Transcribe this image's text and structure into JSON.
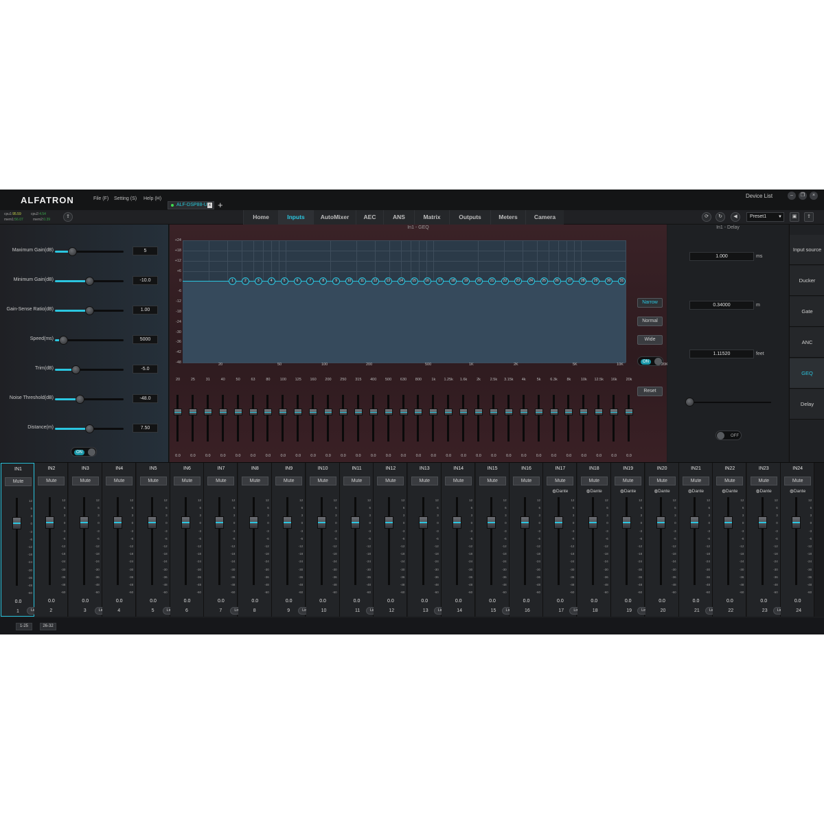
{
  "app": {
    "logo": "ALFATRON",
    "menu": [
      "File (F)",
      "Setting (S)",
      "Help (H)"
    ],
    "device_tab": "ALF-DSP88-U",
    "device_tab_close": "x",
    "add_tab": "+",
    "device_list": "Device List",
    "window_buttons": [
      "–",
      "❐",
      "×"
    ]
  },
  "status": {
    "cpu1_label": "cpu1:",
    "cpu1_value": "95.59",
    "cpu2_label": "cpu2:",
    "cpu2_value": "4.54",
    "mem1_label": "mem1:",
    "mem1_value": "56.07",
    "mem2_label": "mem2:",
    "mem2_value": "0.39"
  },
  "nav": {
    "tabs": [
      "Home",
      "Inputs",
      "AutoMixer",
      "AEC",
      "ANS",
      "Matrix",
      "Outputs",
      "Meters",
      "Camera"
    ],
    "active_tab": "Inputs",
    "preset": "Preset1"
  },
  "automixer_params": [
    {
      "label": "Maximum Gain(dB)",
      "value": "5",
      "level": 0.25
    },
    {
      "label": "Minimum Gain(dB)",
      "value": "-10.0",
      "level": 0.5
    },
    {
      "label": "Gain-Sense Ratio(dB)",
      "value": "1.00",
      "level": 0.5
    },
    {
      "label": "Speed(ms)",
      "value": "5000",
      "level": 0.12
    },
    {
      "label": "Trim(dB)",
      "value": "-5.0",
      "level": 0.3
    },
    {
      "label": "Noise Threshold(dB)",
      "value": "-48.0",
      "level": 0.36
    },
    {
      "label": "Distance(m)",
      "value": "7.50",
      "level": 0.5
    }
  ],
  "automixer_toggle": "ON",
  "geq": {
    "title": "In1 - GEQ",
    "db_labels": [
      "+24",
      "+18",
      "+12",
      "+6",
      "0",
      "-6",
      "-12",
      "-18",
      "-24",
      "-30",
      "-36",
      "-42",
      "-48"
    ],
    "grid_freq_labels": [
      "20",
      "50",
      "100",
      "200",
      "500",
      "1K",
      "2K",
      "5K",
      "10K",
      "20K"
    ],
    "bands": [
      "20",
      "25",
      "31",
      "40",
      "50",
      "63",
      "80",
      "100",
      "125",
      "160",
      "200",
      "250",
      "315",
      "400",
      "500",
      "630",
      "800",
      "1k",
      "1.25k",
      "1.6k",
      "2k",
      "2.5k",
      "3.15k",
      "4k",
      "5k",
      "6.3k",
      "8k",
      "10k",
      "12.5k",
      "16k",
      "20k"
    ],
    "band_values": [
      "0.0",
      "0.0",
      "0.0",
      "0.0",
      "0.0",
      "0.0",
      "0.0",
      "0.0",
      "0.0",
      "0.0",
      "0.0",
      "0.0",
      "0.0",
      "0.0",
      "0.0",
      "0.0",
      "0.0",
      "0.0",
      "0.0",
      "0.0",
      "0.0",
      "0.0",
      "0.0",
      "0.0",
      "0.0",
      "0.0",
      "0.0",
      "0.0",
      "0.0",
      "0.0",
      "0.0"
    ],
    "q_buttons": [
      "Narrow",
      "Normal",
      "Wide"
    ],
    "active_q": "Narrow",
    "toggle": "ON",
    "reset": "Reset"
  },
  "delay": {
    "title": "In1 - Delay",
    "ms_value": "1.000",
    "ms_unit": "ms",
    "m_value": "0.34000",
    "m_unit": "m",
    "feet_value": "1.11520",
    "feet_unit": "feet",
    "toggle": "OFF"
  },
  "side_menu": {
    "items": [
      "Input source",
      "Ducker",
      "Gate",
      "ANC",
      "GEQ",
      "Delay"
    ],
    "active": "GEQ"
  },
  "channels": {
    "mute_label": "Mute",
    "link_label": "Link",
    "dante_label": "Dante",
    "scale": [
      "12",
      "6",
      "3",
      "0",
      "-3",
      "-6",
      "-12",
      "-18",
      "-24",
      "-30",
      "-36",
      "-48",
      "-60"
    ],
    "items": [
      {
        "name": "IN1",
        "value": "0.0",
        "num": "1",
        "dante": false
      },
      {
        "name": "IN2",
        "value": "0.0",
        "num": "2",
        "dante": false
      },
      {
        "name": "IN3",
        "value": "0.0",
        "num": "3",
        "dante": false
      },
      {
        "name": "IN4",
        "value": "0.0",
        "num": "4",
        "dante": false
      },
      {
        "name": "IN5",
        "value": "0.0",
        "num": "5",
        "dante": false
      },
      {
        "name": "IN6",
        "value": "0.0",
        "num": "6",
        "dante": false
      },
      {
        "name": "IN7",
        "value": "0.0",
        "num": "7",
        "dante": false
      },
      {
        "name": "IN8",
        "value": "0.0",
        "num": "8",
        "dante": false
      },
      {
        "name": "IN9",
        "value": "0.0",
        "num": "9",
        "dante": false
      },
      {
        "name": "IN10",
        "value": "0.0",
        "num": "10",
        "dante": false
      },
      {
        "name": "IN11",
        "value": "0.0",
        "num": "11",
        "dante": false
      },
      {
        "name": "IN12",
        "value": "0.0",
        "num": "12",
        "dante": false
      },
      {
        "name": "IN13",
        "value": "0.0",
        "num": "13",
        "dante": false
      },
      {
        "name": "IN14",
        "value": "0.0",
        "num": "14",
        "dante": false
      },
      {
        "name": "IN15",
        "value": "0.0",
        "num": "15",
        "dante": false
      },
      {
        "name": "IN16",
        "value": "0.0",
        "num": "16",
        "dante": false
      },
      {
        "name": "IN17",
        "value": "0.0",
        "num": "17",
        "dante": true
      },
      {
        "name": "IN18",
        "value": "0.0",
        "num": "18",
        "dante": true
      },
      {
        "name": "IN19",
        "value": "0.0",
        "num": "19",
        "dante": true
      },
      {
        "name": "IN20",
        "value": "0.0",
        "num": "20",
        "dante": true
      },
      {
        "name": "IN21",
        "value": "0.0",
        "num": "21",
        "dante": true
      },
      {
        "name": "IN22",
        "value": "0.0",
        "num": "22",
        "dante": true
      },
      {
        "name": "IN23",
        "value": "0.0",
        "num": "23",
        "dante": true
      },
      {
        "name": "IN24",
        "value": "0.0",
        "num": "24",
        "dante": true
      }
    ]
  },
  "pages": [
    "1-25",
    "26-32"
  ],
  "colors": {
    "accent": "#2bc6e0",
    "background": "#1b1c1e"
  }
}
